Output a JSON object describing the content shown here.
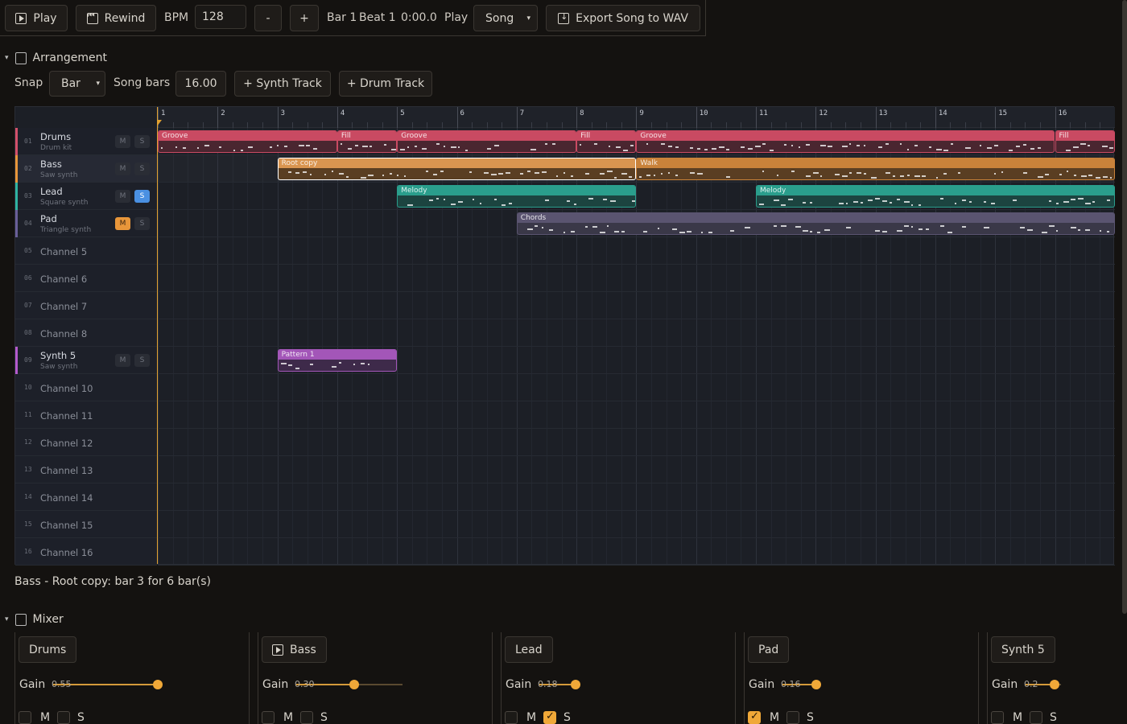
{
  "toolbar": {
    "play_label": "Play",
    "rewind_label": "Rewind",
    "bpm_label": "BPM",
    "bpm_value": "128",
    "minus_label": "-",
    "plus_label": "+",
    "bar_label": "Bar 1",
    "beat_label": "Beat 1",
    "time_label": "0:00.0",
    "play_mode_label": "Play",
    "play_mode_value": "Song",
    "export_label": "Export Song to WAV"
  },
  "arrangement": {
    "title": "Arrangement",
    "snap_label": "Snap",
    "snap_value": "Bar",
    "song_bars_label": "Song bars",
    "song_bars_value": "16.00",
    "add_synth_label": "+ Synth Track",
    "add_drum_label": "+ Drum Track",
    "bars": [
      "1",
      "2",
      "3",
      "4",
      "5",
      "6",
      "7",
      "8",
      "9",
      "10",
      "11",
      "12",
      "13",
      "14",
      "15",
      "16"
    ],
    "tracks": [
      {
        "num": "01",
        "name": "Drums",
        "sub": "Drum kit",
        "color": "#d4506a",
        "m": false,
        "s": false,
        "has_ms": true
      },
      {
        "num": "02",
        "name": "Bass",
        "sub": "Saw synth",
        "color": "#e8963a",
        "m": false,
        "s": false,
        "has_ms": true,
        "selected": true
      },
      {
        "num": "03",
        "name": "Lead",
        "sub": "Square synth",
        "color": "#2fb3a0",
        "m": false,
        "s": true,
        "has_ms": true
      },
      {
        "num": "04",
        "name": "Pad",
        "sub": "Triangle synth",
        "color": "#6a5f98",
        "m": true,
        "s": false,
        "has_ms": true
      },
      {
        "num": "05",
        "name": "Channel 5"
      },
      {
        "num": "06",
        "name": "Channel 6"
      },
      {
        "num": "07",
        "name": "Channel 7"
      },
      {
        "num": "08",
        "name": "Channel 8"
      },
      {
        "num": "09",
        "name": "Synth 5",
        "sub": "Saw synth",
        "color": "#b45acc",
        "m": false,
        "s": false,
        "has_ms": true
      },
      {
        "num": "10",
        "name": "Channel 10"
      },
      {
        "num": "11",
        "name": "Channel 11"
      },
      {
        "num": "12",
        "name": "Channel 12"
      },
      {
        "num": "13",
        "name": "Channel 13"
      },
      {
        "num": "14",
        "name": "Channel 14"
      },
      {
        "num": "15",
        "name": "Channel 15"
      },
      {
        "num": "16",
        "name": "Channel 16"
      }
    ],
    "clips": [
      {
        "track": 0,
        "start": 1,
        "len": 3,
        "title": "Groove",
        "color": "#c94a62",
        "body": "#4a2630"
      },
      {
        "track": 0,
        "start": 4,
        "len": 1,
        "title": "Fill",
        "color": "#c94a62",
        "body": "#4a2630"
      },
      {
        "track": 0,
        "start": 5,
        "len": 3,
        "title": "Groove",
        "color": "#c94a62",
        "body": "#4a2630"
      },
      {
        "track": 0,
        "start": 8,
        "len": 1,
        "title": "Fill",
        "color": "#c94a62",
        "body": "#4a2630"
      },
      {
        "track": 0,
        "start": 9,
        "len": 7,
        "title": "Groove",
        "color": "#c94a62",
        "body": "#4a2630"
      },
      {
        "track": 0,
        "start": 16,
        "len": 1,
        "title": "Fill",
        "color": "#c94a62",
        "body": "#4a2630"
      },
      {
        "track": 1,
        "start": 3,
        "len": 6,
        "title": "Root copy",
        "color": "#d99550",
        "body": "#5a3e22",
        "selected": true
      },
      {
        "track": 1,
        "start": 9,
        "len": 8,
        "title": "Walk",
        "color": "#c9823a",
        "body": "#5a3e22"
      },
      {
        "track": 2,
        "start": 5,
        "len": 4,
        "title": "Melody",
        "color": "#2a9e8c",
        "body": "#1c4440"
      },
      {
        "track": 2,
        "start": 11,
        "len": 6,
        "title": "Melody",
        "color": "#2a9e8c",
        "body": "#1c4440"
      },
      {
        "track": 3,
        "start": 7,
        "len": 10,
        "title": "Chords",
        "color": "#5a5470",
        "body": "#3a3848"
      },
      {
        "track": 8,
        "start": 3,
        "len": 2,
        "title": "Pattern 1",
        "color": "#a356b8",
        "body": "#3e2a4a"
      }
    ]
  },
  "status": "Bass - Root copy: bar 3 for 6 bar(s)",
  "mixer": {
    "title": "Mixer",
    "gain_label": "Gain",
    "m_label": "M",
    "s_label": "S",
    "channels": [
      {
        "name": "Drums",
        "gain": "0.55",
        "gain_value": 0.55,
        "m": false,
        "s": false,
        "playing": false
      },
      {
        "name": "Bass",
        "gain": "0.30",
        "gain_value": 0.3,
        "m": false,
        "s": false,
        "playing": true
      },
      {
        "name": "Lead",
        "gain": "0.18",
        "gain_value": 0.18,
        "m": false,
        "s": true,
        "playing": false
      },
      {
        "name": "Pad",
        "gain": "0.16",
        "gain_value": 0.16,
        "m": true,
        "s": false,
        "playing": false
      },
      {
        "name": "Synth 5",
        "gain": "0.2",
        "gain_value": 0.2,
        "m": false,
        "s": false,
        "playing": false
      }
    ]
  }
}
